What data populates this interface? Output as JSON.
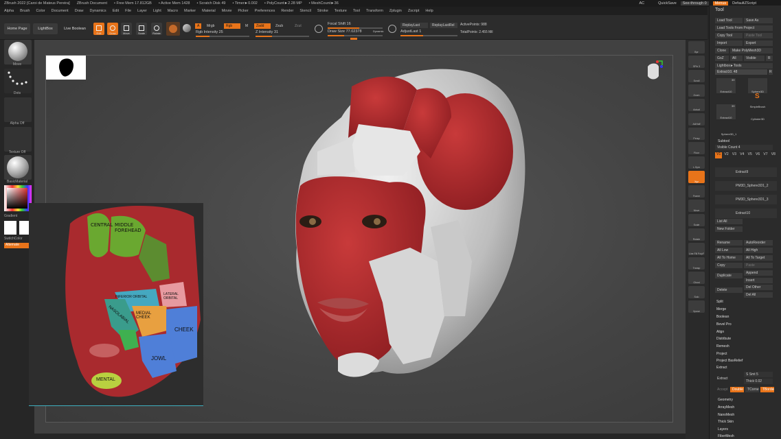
{
  "titlebar": {
    "items": [
      "ZBrush 2022 [Caroi de Mateus Pereira]",
      "ZBrush Document",
      "• Free Mem 17.812GB",
      "• Active Mem 1428",
      "• Scratch Disk 49",
      "• Timer►0.002",
      "• PolyCount►2.28 MP",
      "• MeshCount►36"
    ],
    "right": {
      "ac": "AC",
      "quicksave": "QuickSave",
      "seethrough": "See-through  0",
      "menus": "Menus",
      "script": "DefaultZScript"
    }
  },
  "menubar": [
    "Alpha",
    "Brush",
    "Color",
    "Document",
    "Draw",
    "Dynamics",
    "Edit",
    "File",
    "Layer",
    "Light",
    "Macro",
    "Marker",
    "Material",
    "Movie",
    "Picker",
    "Preferences",
    "Render",
    "Stencil",
    "Stroke",
    "Texture",
    "Tool",
    "Transform",
    "Zplugin",
    "Zscript",
    "Help"
  ],
  "toolbar": {
    "home_page": "Home Page",
    "lightbox": "LightBox",
    "live_boolean": "Live Boolean",
    "edit": "Edit",
    "draw": "Draw",
    "move": "Move",
    "scale": "Scale",
    "rotate": "Rotate",
    "a": "A",
    "mrgb": "Mrgb",
    "rgb": "Rgb",
    "m": "M",
    "rgb_intensity": "Rgb Intensity 25",
    "zadd": "Zadd",
    "zsub": "Zsub",
    "zcut": "Zcut",
    "z_intensity": "Z Intensity 31",
    "focal_shift": "Focal Shift 16",
    "draw_size": "Draw Size 77.02378",
    "dynamic": "Dynamic",
    "replay_last": "ReplayLast",
    "replay_last_rel": "ReplayLastRel",
    "adjust_last": "AdjustLast  1",
    "active_points": "ActivePoints: 988",
    "total_points": "TotalPoints: 2.455 Mil"
  },
  "leftbar": {
    "move": "Move",
    "dots": "Dots",
    "alpha_off": "Alpha Off",
    "texture_off": "Texture Off",
    "basic_material": "BasicMaterial",
    "gradient": "Gradient",
    "switch_color": "SwitchColor",
    "alternate": "Alternate"
  },
  "overlay_labels": [
    "CENTRAL",
    "MIDDLE FOREHEAD",
    "INFERIOR ORBITAL",
    "LATERAL ORBITAL",
    "NASOLABIAL",
    "MEDIAL CHEEK",
    "CHEEK",
    "JOWL",
    "MENTAL"
  ],
  "rightbar": [
    "Bpr",
    "SPix 3",
    "Scroll",
    "Zoom",
    "Actual",
    "AAHalf",
    "Persp",
    "Floor",
    "L.Sym",
    "Xyz",
    "Frame",
    "Move",
    "Scale",
    "Rotate",
    "Line Fill PolyF",
    "Transp",
    "Ghost",
    "Solo",
    "Xpose"
  ],
  "toolpanel": {
    "title": "Tool",
    "load_tool": "Load Tool",
    "save_as": "Save As",
    "load_tools_from_project": "Load Tools From Project",
    "copy_tool": "Copy Tool",
    "paste_tool": "Paste Tool",
    "import": "Import",
    "export": "Export",
    "clone": "Clone",
    "make_polymesh": "Make PolyMesh3D",
    "goz": "GoZ",
    "all": "All",
    "visible": "Visible",
    "r": "R",
    "lightbox_tools": "Lightbox►Tools",
    "extract_slider": "Extract10. 48",
    "r2": "R",
    "thumbs": [
      "Extract10",
      "Sphere3D",
      "Extract10",
      "SimpleBrush",
      "Cylinder3D",
      "Sphere3D_1"
    ],
    "thumb_counts": [
      "39",
      "39"
    ],
    "subtool": "Subtool",
    "visible_count": "Visible Count  4",
    "versions": [
      "V1",
      "V2",
      "V3",
      "V4",
      "V5",
      "V6",
      "V7",
      "V8"
    ],
    "subtools": [
      "Extract9",
      "PM3D_Sphere3D1_2",
      "PM3D_Sphere3D1_3",
      "Extract10"
    ],
    "list_all": "List All",
    "new_folder": "New Folder",
    "rename": "Rename",
    "auto_reorder": "AutoReorder",
    "all_low": "All Low",
    "all_high": "All High",
    "all_to_home": "All To Home",
    "all_to_target": "All To Target",
    "copy": "Copy",
    "paste": "Paste",
    "append": "Append",
    "duplicate": "Duplicate",
    "insert": "Insert",
    "delete": "Delete",
    "del_other": "Del Other",
    "del_all": "Del All",
    "split": "Split",
    "merge": "Merge",
    "boolean": "Boolean",
    "bevel_pro": "Bevel Pro",
    "align": "Align",
    "distribute": "Distribute",
    "remesh": "Remesh",
    "project": "Project",
    "project_basrelief": "Project BasRelief",
    "extract_section": "Extract",
    "extract": "Extract",
    "s_smt": "S Smt  5",
    "thick": "Thick  0.02",
    "accept": "Accept",
    "double": "Double",
    "tcorne": "TCorne",
    "tborder": "TBorder",
    "geometry": "Geometry",
    "arraymesh": "ArrayMesh",
    "nanomesh": "NanoMesh",
    "thick_skin": "Thick Skin",
    "layers": "Layers",
    "fibermesh": "FiberMesh"
  },
  "colors": {
    "accent": "#e8741a",
    "muscle_red": "#b3262a",
    "fascia_white": "#e2e2e2"
  }
}
